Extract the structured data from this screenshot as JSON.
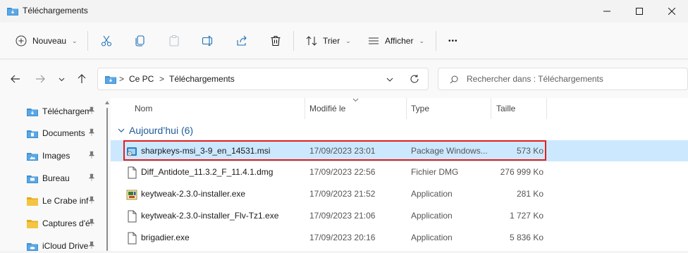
{
  "window": {
    "title": "Téléchargements",
    "controls": [
      "minimize",
      "maximize",
      "close"
    ]
  },
  "toolbar": {
    "new_label": "Nouveau",
    "sort_label": "Trier",
    "view_label": "Afficher",
    "more_label": "•••"
  },
  "address": {
    "crumbs": [
      "Ce PC",
      "Téléchargements"
    ],
    "separator": ">"
  },
  "search": {
    "placeholder": "Rechercher dans : Téléchargements"
  },
  "sidebar": {
    "items": [
      {
        "label": "Téléchargem",
        "icon": "download-folder-icon",
        "pinned": true
      },
      {
        "label": "Documents",
        "icon": "documents-folder-icon",
        "pinned": true
      },
      {
        "label": "Images",
        "icon": "pictures-folder-icon",
        "pinned": true
      },
      {
        "label": "Bureau",
        "icon": "desktop-folder-icon",
        "pinned": true
      },
      {
        "label": "Le Crabe inf",
        "icon": "folder-icon",
        "pinned": true
      },
      {
        "label": "Captures d'é",
        "icon": "folder-icon",
        "pinned": true
      },
      {
        "label": "iCloud Drive",
        "icon": "icloud-folder-icon",
        "pinned": true
      }
    ]
  },
  "columns": {
    "name": "Nom",
    "modified": "Modifié le",
    "type": "Type",
    "size": "Taille"
  },
  "group": {
    "label": "Aujourd’hui (6)"
  },
  "files": [
    {
      "name": "sharpkeys-msi_3-9_en_14531.msi",
      "date": "17/09/2023 23:01",
      "type": "Package Windows...",
      "size": "573 Ko",
      "icon": "msi-icon",
      "selected": true
    },
    {
      "name": "Diff_Antidote_11.3.2_F_11.4.1.dmg",
      "date": "17/09/2023 22:56",
      "type": "Fichier DMG",
      "size": "276 999 Ko",
      "icon": "file-icon",
      "selected": false
    },
    {
      "name": "keytweak-2.3.0-installer.exe",
      "date": "17/09/2023 21:52",
      "type": "Application",
      "size": "281 Ko",
      "icon": "installer-icon",
      "selected": false
    },
    {
      "name": "keytweak-2.3.0-installer_Flv-Tz1.exe",
      "date": "17/09/2023 21:06",
      "type": "Application",
      "size": "1 727 Ko",
      "icon": "file-icon",
      "selected": false
    },
    {
      "name": "brigadier.exe",
      "date": "17/09/2023 20:16",
      "type": "Application",
      "size": "5 836 Ko",
      "icon": "file-icon",
      "selected": false
    }
  ],
  "colors": {
    "selection": "#cce8ff",
    "highlight": "#e21e1e",
    "group": "#1f5c99",
    "folder_blue": "#3d8fd1",
    "folder_yellow": "#f4c542"
  }
}
